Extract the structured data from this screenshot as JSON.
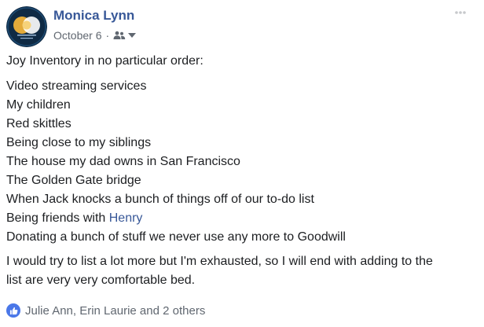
{
  "post": {
    "author": "Monica Lynn",
    "date": "October 6",
    "separator": "·",
    "audience_icon": "friends-icon",
    "intro": "Joy Inventory in no particular order:",
    "list": [
      "Video streaming services",
      "My children",
      "Red skittles",
      "Being close to my siblings",
      "The house my dad owns in San Francisco",
      "The Golden Gate bridge",
      "When Jack knocks a bunch of things off of our to-do list"
    ],
    "friends_line_prefix": "Being friends with ",
    "friends_line_mention": "Henry",
    "last_list_item": "Donating a bunch of stuff we never use any more to Goodwill",
    "closing_line1": "I would try to list a lot more but I'm exhausted, so I will end with adding to the",
    "closing_line2": "list are very very comfortable bed.",
    "reactions_text": "Julie Ann, Erin Laurie and 2 others",
    "colors": {
      "link": "#385898",
      "meta": "#606770",
      "like": "#4a77e8"
    }
  }
}
